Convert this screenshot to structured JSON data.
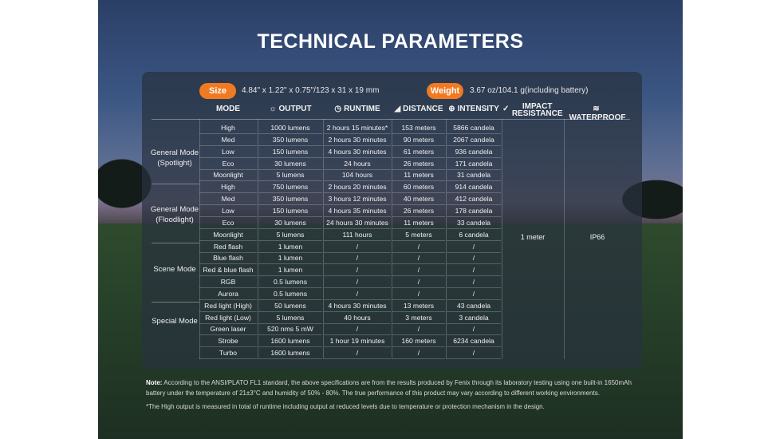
{
  "title": "TECHNICAL PARAMETERS",
  "specs": {
    "size_label": "Size",
    "size_value": "4.84\" x 1.22\" x 0.75\"/123 x 31 x 19 mm",
    "weight_label": "Weight",
    "weight_value": "3.67 oz/104.1 g(including battery)"
  },
  "headers": {
    "mode": "MODE",
    "output": "OUTPUT",
    "runtime": "RUNTIME",
    "distance": "DISTANCE",
    "intensity": "INTENSITY",
    "impact": "IMPACT RESISTANCE",
    "waterproof": "WATERPROOF"
  },
  "groups": [
    {
      "label": "General Mode (Spotlight)"
    },
    {
      "label": "General Mode (Floodlight)"
    },
    {
      "label": "Scene Mode"
    },
    {
      "label": "Special Mode"
    }
  ],
  "rows": [
    {
      "mode": "High",
      "output": "1000 lumens",
      "runtime": "2 hours 15 minutes*",
      "distance": "153 meters",
      "intensity": "5866 candela"
    },
    {
      "mode": "Med",
      "output": "350 lumens",
      "runtime": "2 hours 30 minutes",
      "distance": "90 meters",
      "intensity": "2067 candela"
    },
    {
      "mode": "Low",
      "output": "150 lumens",
      "runtime": "4 hours 30 minutes",
      "distance": "61 meters",
      "intensity": "936 candela"
    },
    {
      "mode": "Eco",
      "output": "30 lumens",
      "runtime": "24 hours",
      "distance": "26 meters",
      "intensity": "171 candela"
    },
    {
      "mode": "Moonlight",
      "output": "5 lumens",
      "runtime": "104 hours",
      "distance": "11 meters",
      "intensity": "31 candela"
    },
    {
      "mode": "High",
      "output": "750 lumens",
      "runtime": "2 hours 20 minutes",
      "distance": "60 meters",
      "intensity": "914 candela"
    },
    {
      "mode": "Med",
      "output": "350 lumens",
      "runtime": "3 hours 12 minutes",
      "distance": "40 meters",
      "intensity": "412 candela"
    },
    {
      "mode": "Low",
      "output": "150 lumens",
      "runtime": "4 hours 35 minutes",
      "distance": "26 meters",
      "intensity": "178 candela"
    },
    {
      "mode": "Eco",
      "output": "30 lumens",
      "runtime": "24 hours 30 minutes",
      "distance": "11 meters",
      "intensity": "33 candela"
    },
    {
      "mode": "Moonlight",
      "output": "5 lumens",
      "runtime": "111 hours",
      "distance": "5 meters",
      "intensity": "6 candela"
    },
    {
      "mode": "Red flash",
      "output": "1 lumen",
      "runtime": "/",
      "distance": "/",
      "intensity": "/"
    },
    {
      "mode": "Blue flash",
      "output": "1 lumen",
      "runtime": "/",
      "distance": "/",
      "intensity": "/"
    },
    {
      "mode": "Red & blue flash",
      "output": "1 lumen",
      "runtime": "/",
      "distance": "/",
      "intensity": "/"
    },
    {
      "mode": "RGB",
      "output": "0.5 lumens",
      "runtime": "/",
      "distance": "/",
      "intensity": "/"
    },
    {
      "mode": "Aurora",
      "output": "0.5 lumens",
      "runtime": "/",
      "distance": "/",
      "intensity": "/"
    },
    {
      "mode": "Red light (High)",
      "output": "50 lumens",
      "runtime": "4 hours 30 minutes",
      "distance": "13 meters",
      "intensity": "43 candela"
    },
    {
      "mode": "Red light (Low)",
      "output": "5 lumens",
      "runtime": "40 hours",
      "distance": "3 meters",
      "intensity": "3 candela"
    },
    {
      "mode": "Green laser",
      "output": "520 nms 5 mW",
      "runtime": "/",
      "distance": "/",
      "intensity": "/"
    },
    {
      "mode": "Strobe",
      "output": "1600 lumens",
      "runtime": "1 hour 19 minutes",
      "distance": "160 meters",
      "intensity": "6234 candela"
    },
    {
      "mode": "Turbo",
      "output": "1600 lumens",
      "runtime": "/",
      "distance": "/",
      "intensity": "/"
    }
  ],
  "impact_value": "1 meter",
  "waterproof_value": "IP66",
  "note_label": "Note:",
  "note_text": " According to the ANSI/PLATO FL1 standard, the above specifications are from the results produced by Fenix through its laboratory testing using one built-in 1650mAh battery under the temperature of 21±3°C and humidity of 50% - 80%. The true performance of this product may vary according to different working environments.",
  "footnote": "*The High output is measured in total of runtime including output at reduced levels due to temperature or protection mechanism in the design.",
  "colors": {
    "accent": "#f07a22",
    "panel": "#28323e"
  }
}
